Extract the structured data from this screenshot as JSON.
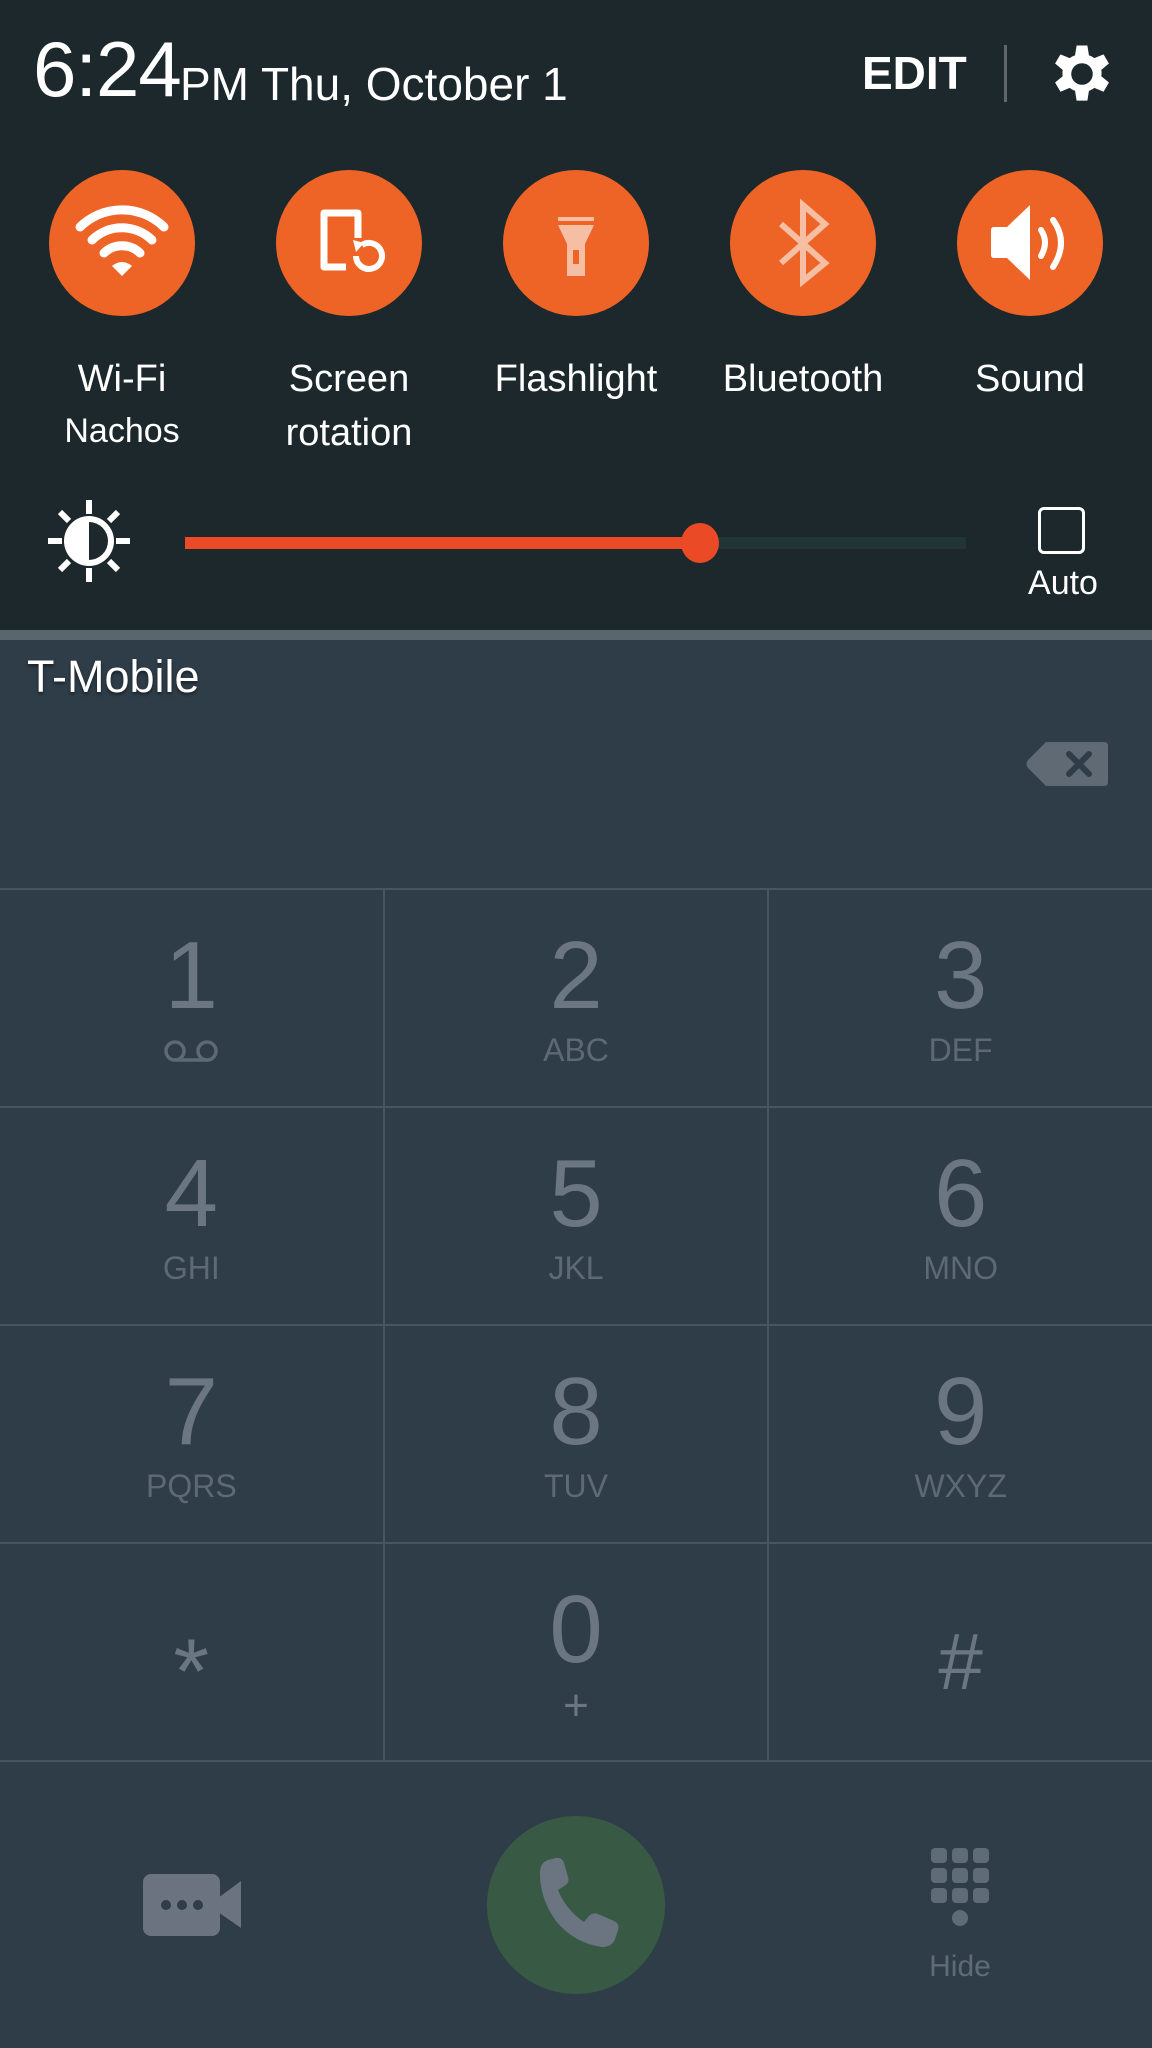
{
  "status": {
    "time": "6:24",
    "date": "PM Thu, October 1",
    "edit_label": "EDIT",
    "settings_icon": "gear-icon"
  },
  "quick_toggles": [
    {
      "label": "Wi-Fi",
      "sublabel": "Nachos",
      "icon": "wifi-icon",
      "state": "on"
    },
    {
      "label": "Screen",
      "label_line2": "rotation",
      "icon": "screen-rotation-icon",
      "state": "on"
    },
    {
      "label": "Flashlight",
      "icon": "flashlight-icon",
      "state": "off"
    },
    {
      "label": "Bluetooth",
      "icon": "bluetooth-icon",
      "state": "off"
    },
    {
      "label": "Sound",
      "icon": "sound-icon",
      "state": "on"
    }
  ],
  "brightness": {
    "icon": "brightness-icon",
    "level": 0.66,
    "auto_label": "Auto",
    "auto_checked": false
  },
  "dialer": {
    "carrier": "T-Mobile",
    "number_value": "",
    "backspace_icon": "backspace-icon",
    "keys": [
      [
        {
          "digit": "1",
          "letters": "",
          "icon": "voicemail-icon"
        },
        {
          "digit": "2",
          "letters": "ABC"
        },
        {
          "digit": "3",
          "letters": "DEF"
        }
      ],
      [
        {
          "digit": "4",
          "letters": "GHI"
        },
        {
          "digit": "5",
          "letters": "JKL"
        },
        {
          "digit": "6",
          "letters": "MNO"
        }
      ],
      [
        {
          "digit": "7",
          "letters": "PQRS"
        },
        {
          "digit": "8",
          "letters": "TUV"
        },
        {
          "digit": "9",
          "letters": "WXYZ"
        }
      ],
      [
        {
          "digit": "*",
          "letters": ""
        },
        {
          "digit": "0",
          "letters": "+"
        },
        {
          "digit": "#",
          "letters": ""
        }
      ]
    ],
    "video_call_icon": "video-call-icon",
    "call_icon": "phone-icon",
    "hide_label": "Hide"
  },
  "colors": {
    "toggle_active": "#ee6426",
    "slider": "#ea4a25",
    "call_button": "#385a44",
    "panel_bg": "#1d282c",
    "dialer_bg": "#2e3d48"
  }
}
